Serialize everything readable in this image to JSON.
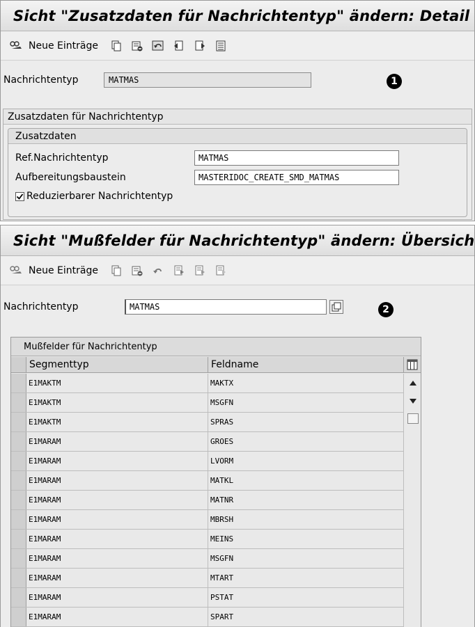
{
  "panel1": {
    "title": "Sicht \"Zusatzdaten für Nachrichtentyp\" ändern: Detail",
    "toolbar": {
      "new_entries_icon": "glasses-icon",
      "new_entries_label": "Neue Einträge",
      "icons": [
        "copy-icon",
        "delete-icon",
        "undo-icon",
        "previous-entry-icon",
        "next-entry-icon",
        "select-block-icon"
      ]
    },
    "message_type_label": "Nachrichtentyp",
    "message_type_value": "MATMAS",
    "marker": "1",
    "outer_group_title": "Zusatzdaten für Nachrichtentyp",
    "inner_group_title": "Zusatzdaten",
    "ref_label": "Ref.Nachrichtentyp",
    "ref_value": "MATMAS",
    "aufb_label": "Aufbereitungsbaustein",
    "aufb_value": "MASTERIDOC_CREATE_SMD_MATMAS",
    "reducible_label": "Reduzierbarer Nachrichtentyp",
    "reducible_checked": true
  },
  "panel2": {
    "title": "Sicht \"Mußfelder für Nachrichtentyp\" ändern: Übersicht",
    "toolbar": {
      "new_entries_icon": "glasses-icon",
      "new_entries_label": "Neue Einträge",
      "icons": [
        "copy-icon",
        "delete-icon",
        "undo-icon",
        "select-all-icon",
        "select-block-icon",
        "deselect-all-icon"
      ]
    },
    "message_type_label": "Nachrichtentyp",
    "message_type_value": "MATMAS",
    "marker": "2",
    "table": {
      "title": "Mußfelder für Nachrichtentyp",
      "columns": [
        "Segmenttyp",
        "Feldname"
      ],
      "rows": [
        [
          "E1MAKTM",
          "MAKTX"
        ],
        [
          "E1MAKTM",
          "MSGFN"
        ],
        [
          "E1MAKTM",
          "SPRAS"
        ],
        [
          "E1MARAM",
          "GROES"
        ],
        [
          "E1MARAM",
          "LVORM"
        ],
        [
          "E1MARAM",
          "MATKL"
        ],
        [
          "E1MARAM",
          "MATNR"
        ],
        [
          "E1MARAM",
          "MBRSH"
        ],
        [
          "E1MARAM",
          "MEINS"
        ],
        [
          "E1MARAM",
          "MSGFN"
        ],
        [
          "E1MARAM",
          "MTART"
        ],
        [
          "E1MARAM",
          "PSTAT"
        ],
        [
          "E1MARAM",
          "SPART"
        ]
      ]
    }
  }
}
